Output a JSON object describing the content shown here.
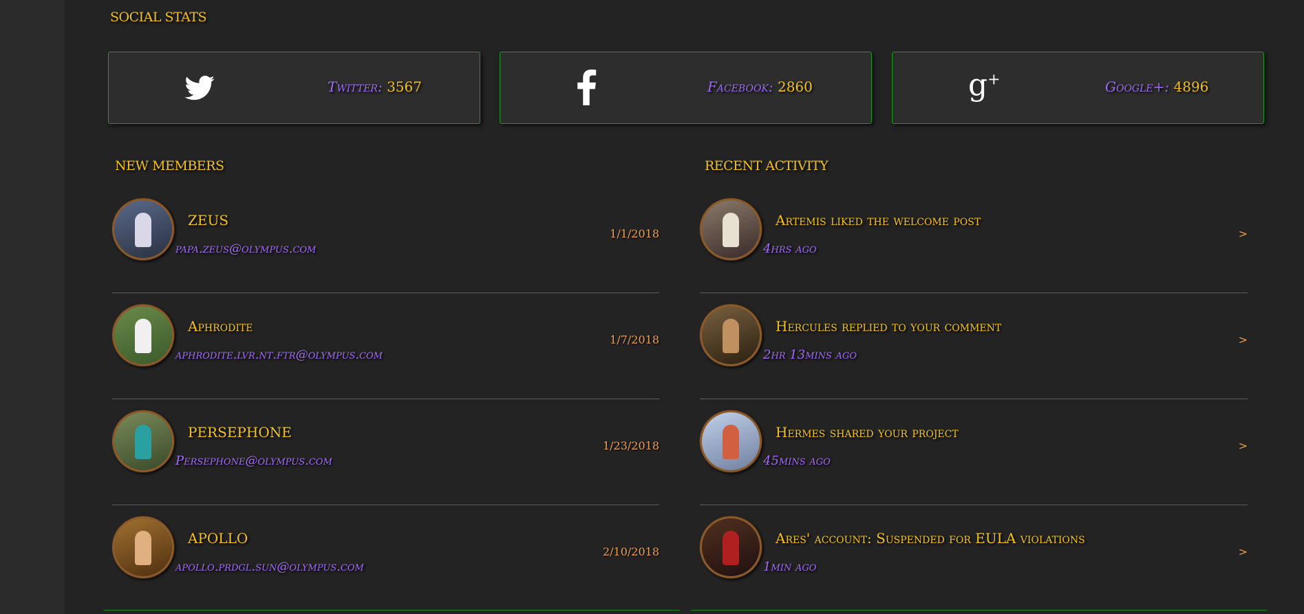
{
  "social": {
    "heading": "SOCIAL STATS",
    "cards": [
      {
        "icon": "twitter-icon",
        "label": "Twitter:",
        "value": "3567"
      },
      {
        "icon": "facebook-icon",
        "label": "Facebook:",
        "value": "2860"
      },
      {
        "icon": "google-plus-icon",
        "label": "Google+:",
        "value": "4896"
      }
    ]
  },
  "members": {
    "heading": "NEW MEMBERS",
    "items": [
      {
        "name": "ZEUS",
        "email": "papa.zeus@olympus.com",
        "date": "1/1/2018"
      },
      {
        "name": "Aphrodite",
        "email": "aphrodite.lvr.nt.ftr@olympus.com",
        "date": "1/7/2018"
      },
      {
        "name": "PERSEPHONE",
        "email": "Persephone@olympus.com",
        "date": "1/23/2018"
      },
      {
        "name": "APOLLO",
        "email": "apollo.prdgl.sun@olympus.com",
        "date": "2/10/2018"
      }
    ]
  },
  "activity": {
    "heading": "RECENT ACTIVITY",
    "items": [
      {
        "text": "Artemis liked the welcome post",
        "time": "4hrs ago",
        "arrow": ">"
      },
      {
        "text": "Hercules replied to your comment",
        "time": "2hr 13mins ago",
        "arrow": ">"
      },
      {
        "text": "Hermes shared your project",
        "time": "45mins ago",
        "arrow": ">"
      },
      {
        "text": "Ares' account: Suspended for EULA violations",
        "time": "1min ago",
        "arrow": ">"
      }
    ]
  },
  "colors": {
    "accent_gold": "#f2c21b",
    "accent_purple": "#9b6cf0",
    "accent_orange": "#f0a050",
    "border_green": "#1f9a1f"
  }
}
